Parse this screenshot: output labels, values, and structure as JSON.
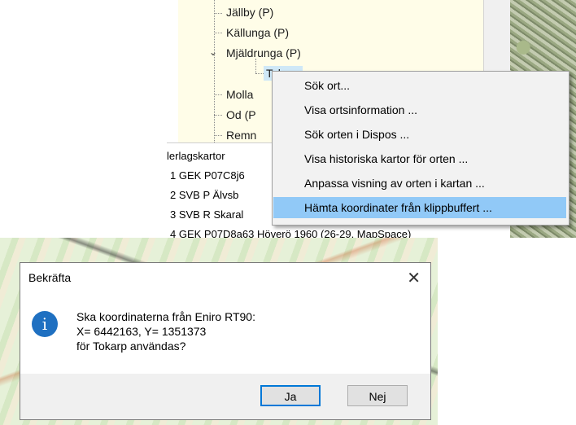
{
  "tree": {
    "items": [
      {
        "label": "Jällby (P)"
      },
      {
        "label": "Källunga (P)"
      },
      {
        "label": "Mjäldrunga (P)"
      },
      {
        "label": "Tokarp"
      },
      {
        "label": "Molla"
      },
      {
        "label": "Od (P"
      },
      {
        "label": "Remn"
      }
    ]
  },
  "layers": {
    "header": "lerlagskartor",
    "items": [
      {
        "label": "1  GEK P07C8j6"
      },
      {
        "label": "2  SVB P Älvsb"
      },
      {
        "label": "3  SVB R Skaral"
      },
      {
        "label": "4  GEK P07D8a63 Höverö 1960 (26-29, MapSpace)"
      }
    ]
  },
  "context_menu": {
    "items": [
      {
        "label": "Sök ort..."
      },
      {
        "label": "Visa ortsinformation ..."
      },
      {
        "label": "Sök orten i Dispos ..."
      },
      {
        "label": "Visa historiska kartor för orten ..."
      },
      {
        "label": "Anpassa visning av orten i kartan ..."
      },
      {
        "label": "Hämta koordinater från klippbuffert ..."
      }
    ],
    "highlight_color": "#91c9f7"
  },
  "dialog": {
    "title": "Bekräfta",
    "icon": "info-icon",
    "icon_glyph": "i",
    "close_glyph": "✕",
    "message_lines": [
      "Ska koordinaterna från Eniro RT90:",
      "X= 6442163, Y= 1351373",
      "för Tokarp användas?"
    ],
    "yes_label": "Ja",
    "no_label": "Nej",
    "accent": "#0078d7"
  }
}
